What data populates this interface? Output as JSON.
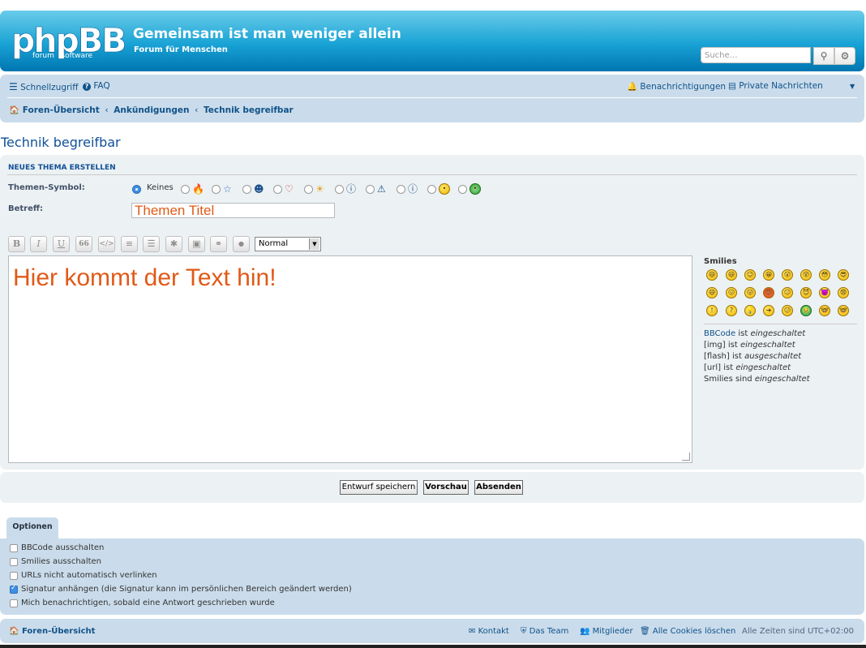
{
  "header": {
    "logo_text": "phpBB",
    "logo_sub": "forum   software",
    "title": "Gemeinsam ist man weniger allein",
    "description": "Forum für Menschen",
    "search_placeholder": "Suche…"
  },
  "nav": {
    "quick_links": "Schnellzugriff",
    "faq": "FAQ",
    "notifications": "Benachrichtigungen",
    "private_messages": "Private Nachrichten"
  },
  "breadcrumbs": [
    "Foren-Übersicht",
    "Ankündigungen",
    "Technik begreifbar"
  ],
  "page_title": "Technik begreifbar",
  "post": {
    "heading": "NEUES THEMA ERSTELLEN",
    "icon_label": "Themen-Symbol:",
    "icon_none": "Keines",
    "subject_label": "Betreff:",
    "subject_value": "Themen Titel",
    "font_size_value": "Normal",
    "message": "Hier kommt der Text hin!",
    "toolbar": [
      "B",
      "I",
      "U",
      "66",
      "</>",
      "≡",
      "☰",
      "✱",
      "▣",
      "⚭",
      "●"
    ]
  },
  "smilies": {
    "heading": "Smilies",
    "faces": [
      "😄",
      "😆",
      "😉",
      "😁",
      "😲",
      "😵",
      "😳",
      "😎",
      "😄",
      "😖",
      "😛",
      "😡",
      "😐",
      "😈",
      "👿",
      "😨",
      "!",
      "?",
      "💡",
      "➜",
      "😕",
      "🤢",
      "🤓",
      "🤓"
    ]
  },
  "bbinfo": {
    "bbcode_link": "BBCode",
    "ist": "ist",
    "eingeschaltet": "eingeschaltet",
    "ausgeschaltet": "ausgeschaltet",
    "img": "[img]",
    "flash": "[flash]",
    "url": "[url]",
    "smilies": "Smilies",
    "sind": "sind"
  },
  "buttons": {
    "save_draft": "Entwurf speichern",
    "preview": "Vorschau",
    "submit": "Absenden"
  },
  "options": {
    "tab": "Optionen",
    "items": [
      {
        "label": "BBCode ausschalten",
        "checked": false
      },
      {
        "label": "Smilies ausschalten",
        "checked": false
      },
      {
        "label": "URLs nicht automatisch verlinken",
        "checked": false
      },
      {
        "label": "Signatur anhängen (die Signatur kann im persönlichen Bereich geändert werden)",
        "checked": true
      },
      {
        "label": "Mich benachrichtigen, sobald eine Antwort geschrieben wurde",
        "checked": false
      }
    ]
  },
  "footer": {
    "index": "Foren-Übersicht",
    "contact": "Kontakt",
    "team": "Das Team",
    "members": "Mitglieder",
    "delete_cookies": "Alle Cookies löschen",
    "timezone": "Alle Zeiten sind UTC+02:00"
  },
  "colors": {
    "accent": "#105289",
    "header": "#19a3d5",
    "panel": "#cadceb",
    "editor_text": "#e05a17"
  }
}
